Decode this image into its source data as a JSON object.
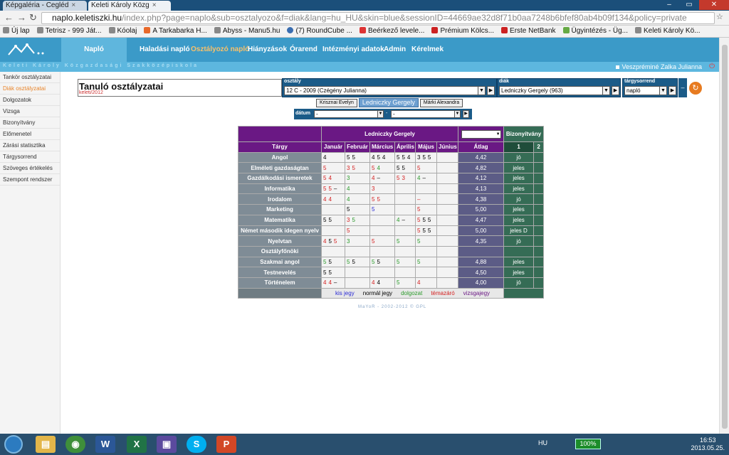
{
  "browser": {
    "tabs": [
      {
        "label": "Képgaléria - Cegléd"
      },
      {
        "label": "Keleti Károly Közg"
      }
    ],
    "url_host": "naplo.keletiszki.hu",
    "url_path": "/index.php?page=naplo&sub=osztalyozo&f=diak&lang=hu_HU&skin=blue&sessionID=44669ae32d8f71b0aa7248b6bfef80ab4b09f134&policy=private",
    "bookmarks": [
      "Új lap",
      "Tetrisz - 999 Ját...",
      "Kóolaj",
      "A Tarkabarka H...",
      "Abyss - Manu5.hu",
      "(7) RoundCube ...",
      "Beérkező levele...",
      "Prémium Kölcs...",
      "Erste NetBank",
      "Ügyintézés - Üg...",
      "Keleti Károly Kö..."
    ]
  },
  "header": {
    "active": "Napló",
    "nav": [
      "Haladási napló",
      "Osztályozó napló",
      "Hiányzások",
      "Órarend",
      "Intézményi adatok",
      "Admin",
      "Kérelmek"
    ],
    "school_name": "Keleti Károly Közgazdasági Szakközépiskola",
    "user": "Veszpréminé Zalka Julianna"
  },
  "sidebar": {
    "items": [
      "Tankör osztályzatai",
      "Diák osztályzatai",
      "Dolgozatok",
      "Vizsga",
      "Bizonyítvány",
      "Előmenetel",
      "Zárási statisztika",
      "Tárgysorrend",
      "Szöveges értékelés",
      "Szempont rendszer"
    ]
  },
  "page": {
    "title": "Tanuló osztályzatai",
    "subtitle": "keleti/2012"
  },
  "filters": {
    "osztaly_label": "osztály",
    "osztaly_value": "12 C - 2009 (Czégény Julianna)",
    "diak_label": "diák",
    "diak_value": "Ledniczky Gergely (963)",
    "sorrend_label": "tárgysorrend",
    "sorrend_value": "napló",
    "datum_label": "dátum",
    "datum_from": "-",
    "datum_to": "-"
  },
  "student_nav": {
    "prev": "Krisznai Evelyn",
    "current": "Ledniczky Gergely",
    "next": "Márki Alexandra"
  },
  "grades": {
    "student": "Ledniczky Gergely",
    "bizonyitvany_label": "Bizonyítvány",
    "col_subject": "Tárgy",
    "months": [
      "Január",
      "Február",
      "Március",
      "Április",
      "Május",
      "Június"
    ],
    "col_avg": "Átlag",
    "bz_cols": [
      "1",
      "2"
    ],
    "rows": [
      {
        "subject": "Angol",
        "months": [
          [
            [
              "4",
              "n"
            ]
          ],
          [
            [
              "5",
              "n"
            ],
            [
              "5",
              "n"
            ]
          ],
          [
            [
              "4",
              "n"
            ],
            [
              "5",
              "n"
            ],
            [
              "4",
              "n"
            ]
          ],
          [
            [
              "5",
              "n"
            ],
            [
              "5",
              "n"
            ],
            [
              "4",
              "n"
            ]
          ],
          [
            [
              "3",
              "n"
            ],
            [
              "5",
              "n"
            ],
            [
              "5",
              "n"
            ]
          ],
          []
        ],
        "avg": "4,42",
        "bz": "jó"
      },
      {
        "subject": "Elméleti gazdaságtan",
        "months": [
          [
            [
              "5",
              "r"
            ]
          ],
          [
            [
              "3",
              "r"
            ],
            [
              "5",
              "r"
            ]
          ],
          [
            [
              "5",
              "r"
            ],
            [
              "4",
              "g"
            ]
          ],
          [
            [
              "5",
              "n"
            ],
            [
              "5",
              "n"
            ]
          ],
          [
            [
              "5",
              "r"
            ]
          ],
          []
        ],
        "avg": "4,82",
        "bz": "jeles"
      },
      {
        "subject": "Gazdálkodási ismeretek",
        "months": [
          [
            [
              "5",
              "r"
            ],
            [
              "4",
              "r"
            ]
          ],
          [
            [
              "3",
              "g"
            ]
          ],
          [
            [
              "4",
              "r"
            ],
            [
              "–",
              "n"
            ]
          ],
          [
            [
              "5",
              "r"
            ],
            [
              "3",
              "r"
            ]
          ],
          [
            [
              "4",
              "g"
            ],
            [
              "–",
              "n"
            ]
          ],
          []
        ],
        "avg": "4,12",
        "bz": "jeles"
      },
      {
        "subject": "Informatika",
        "months": [
          [
            [
              "5",
              "r"
            ],
            [
              "5",
              "r"
            ],
            [
              "–",
              "n"
            ]
          ],
          [
            [
              "4",
              "g"
            ]
          ],
          [
            [
              "3",
              "r"
            ]
          ],
          [],
          [],
          []
        ],
        "avg": "4,13",
        "bz": "jeles"
      },
      {
        "subject": "Irodalom",
        "months": [
          [
            [
              "4",
              "r"
            ],
            [
              "4",
              "r"
            ]
          ],
          [
            [
              "4",
              "g"
            ]
          ],
          [
            [
              "5",
              "r"
            ],
            [
              "5",
              "r"
            ]
          ],
          [],
          [
            [
              "–",
              "r"
            ]
          ],
          []
        ],
        "avg": "4,38",
        "bz": "jó"
      },
      {
        "subject": "Marketing",
        "months": [
          [],
          [
            [
              "5",
              "n"
            ]
          ],
          [
            [
              "5",
              "b"
            ]
          ],
          [],
          [
            [
              "5",
              "r"
            ]
          ],
          []
        ],
        "avg": "5,00",
        "bz": "jeles"
      },
      {
        "subject": "Matematika",
        "months": [
          [
            [
              "5",
              "n"
            ],
            [
              "5",
              "n"
            ]
          ],
          [
            [
              "3",
              "r"
            ],
            [
              "5",
              "g"
            ]
          ],
          [],
          [
            [
              "4",
              "g"
            ],
            [
              "–",
              "n"
            ]
          ],
          [
            [
              "5",
              "r"
            ],
            [
              "5",
              "n"
            ],
            [
              "5",
              "n"
            ]
          ],
          []
        ],
        "avg": "4,47",
        "bz": "jeles"
      },
      {
        "subject": "Német második idegen nyelv",
        "months": [
          [],
          [
            [
              "5",
              "r"
            ]
          ],
          [],
          [],
          [
            [
              "5",
              "r"
            ],
            [
              "5",
              "n"
            ],
            [
              "5",
              "n"
            ]
          ],
          []
        ],
        "avg": "5,00",
        "bz": "jeles D"
      },
      {
        "subject": "Nyelvtan",
        "months": [
          [
            [
              "4",
              "r"
            ],
            [
              "5",
              "n"
            ],
            [
              "5",
              "r"
            ]
          ],
          [
            [
              "3",
              "g"
            ]
          ],
          [
            [
              "5",
              "r"
            ]
          ],
          [
            [
              "5",
              "g"
            ]
          ],
          [
            [
              "5",
              "g"
            ]
          ],
          []
        ],
        "avg": "4,35",
        "bz": "jó"
      },
      {
        "subject": "Osztályfőnöki",
        "months": [
          [],
          [],
          [],
          [],
          [],
          []
        ],
        "avg": "",
        "bz": ""
      },
      {
        "subject": "Szakmai angol",
        "months": [
          [
            [
              "5",
              "g"
            ],
            [
              "5",
              "n"
            ]
          ],
          [
            [
              "5",
              "g"
            ],
            [
              "5",
              "n"
            ]
          ],
          [
            [
              "5",
              "g"
            ],
            [
              "5",
              "n"
            ]
          ],
          [
            [
              "5",
              "g"
            ]
          ],
          [
            [
              "5",
              "g"
            ]
          ],
          []
        ],
        "avg": "4,88",
        "bz": "jeles"
      },
      {
        "subject": "Testnevelés",
        "months": [
          [
            [
              "5",
              "n"
            ],
            [
              "5",
              "n"
            ]
          ],
          [],
          [],
          [],
          [],
          []
        ],
        "avg": "4,50",
        "bz": "jeles"
      },
      {
        "subject": "Történelem",
        "months": [
          [
            [
              "4",
              "r"
            ],
            [
              "4",
              "r"
            ],
            [
              "–",
              "n"
            ]
          ],
          [],
          [
            [
              "4",
              "r"
            ],
            [
              "4",
              "n"
            ]
          ],
          [
            [
              "5",
              "g"
            ]
          ],
          [
            [
              "4",
              "r"
            ]
          ],
          []
        ],
        "avg": "4,00",
        "bz": "jó"
      }
    ],
    "legend": [
      {
        "label": "kis jegy",
        "color": "#2a2ad4"
      },
      {
        "label": "normál jegy",
        "color": "#000000"
      },
      {
        "label": "dolgozat",
        "color": "#2a9a2a"
      },
      {
        "label": "témazáró",
        "color": "#d42020"
      },
      {
        "label": "vizsgajegy",
        "color": "#6a1884"
      }
    ]
  },
  "footer": "MaYoR - 2002-2012 © GPL",
  "taskbar": {
    "lang": "HU",
    "battery": "100%",
    "time": "16:53",
    "date": "2013.05.25."
  }
}
